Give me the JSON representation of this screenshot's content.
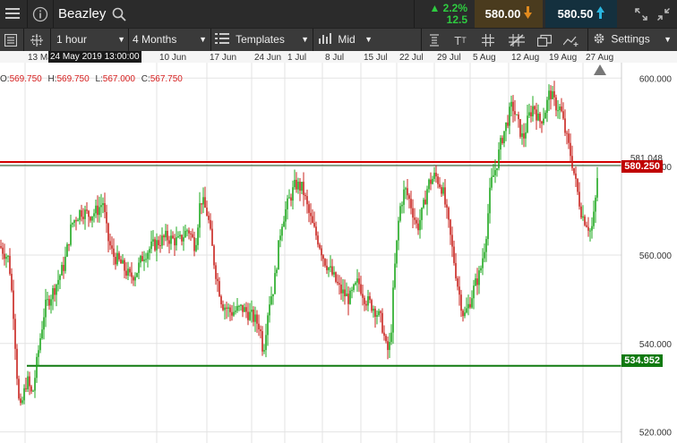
{
  "app": {
    "instrument": "Beazley",
    "change_pct": "▲ 2.2%",
    "change_abs": "12.5",
    "sell_price": "580.00",
    "buy_price": "580.50"
  },
  "toolbar": {
    "interval": "1 hour",
    "range": "4 Months",
    "templates": "Templates",
    "price_type": "Mid",
    "settings": "Settings"
  },
  "crosshair": {
    "date": "24 May 2019 13:00:00",
    "open_label": "O:",
    "open": "569.750",
    "high_label": "H:",
    "high": "569.750",
    "low_label": "L:",
    "low": "567.000",
    "close_label": "C:",
    "close": "567.750"
  },
  "colors": {
    "up": "#1fa81f",
    "down": "#c8231d",
    "resistance": "#d40000",
    "support": "#117a11",
    "price_line": "#1e4d1e"
  },
  "icons": [
    "menu-icon",
    "info-icon",
    "search-icon",
    "down-arrow-icon",
    "up-arrow-icon",
    "expand-icon",
    "collapse-icon",
    "list-icon",
    "crosshair-toggle-icon",
    "date-range-icon",
    "font-size-icon",
    "grid-icon",
    "drawing-tools-icon",
    "multi-window-icon",
    "add-indicator-icon",
    "gear-icon"
  ],
  "chart_data": {
    "type": "candlestick",
    "ylim": [
      517.5,
      603.5
    ],
    "y_ticks": [
      "520.000",
      "540.000",
      "560.000",
      "580.000",
      "600.000"
    ],
    "x_ticks": [
      "13 May",
      "10 Jun",
      "17 Jun",
      "24 Jun",
      "1 Jul",
      "8 Jul",
      "15 Jul",
      "22 Jul",
      "29 Jul",
      "5 Aug",
      "12 Aug",
      "19 Aug",
      "27 Aug"
    ],
    "hidden_tick_value": "581.048",
    "current_price": "580.250",
    "resistance_level": 581.048,
    "support_level": "534.952",
    "support_value": 534.952,
    "series_path": [
      [
        0,
        562
      ],
      [
        10,
        559
      ],
      [
        15,
        547
      ],
      [
        19,
        533
      ],
      [
        22,
        524
      ],
      [
        30,
        532
      ],
      [
        36,
        528
      ],
      [
        44,
        540
      ],
      [
        50,
        548
      ],
      [
        62,
        553
      ],
      [
        72,
        558
      ],
      [
        80,
        567
      ],
      [
        90,
        570
      ],
      [
        100,
        569
      ],
      [
        108,
        570
      ],
      [
        115,
        572
      ],
      [
        120,
        564
      ],
      [
        126,
        560
      ],
      [
        135,
        558
      ],
      [
        145,
        555
      ],
      [
        152,
        556
      ],
      [
        160,
        560
      ],
      [
        170,
        562
      ],
      [
        185,
        564
      ],
      [
        200,
        563
      ],
      [
        210,
        566
      ],
      [
        218,
        562
      ],
      [
        224,
        573
      ],
      [
        232,
        569
      ],
      [
        240,
        557
      ],
      [
        248,
        549
      ],
      [
        258,
        547
      ],
      [
        270,
        548
      ],
      [
        282,
        546
      ],
      [
        290,
        544
      ],
      [
        294,
        538
      ],
      [
        300,
        549
      ],
      [
        306,
        553
      ],
      [
        314,
        567
      ],
      [
        322,
        572
      ],
      [
        330,
        576
      ],
      [
        338,
        575
      ],
      [
        344,
        570
      ],
      [
        350,
        566
      ],
      [
        356,
        563
      ],
      [
        362,
        559
      ],
      [
        370,
        556
      ],
      [
        380,
        552
      ],
      [
        390,
        550
      ],
      [
        400,
        554
      ],
      [
        408,
        550
      ],
      [
        418,
        548
      ],
      [
        426,
        545
      ],
      [
        432,
        538
      ],
      [
        436,
        540
      ],
      [
        440,
        555
      ],
      [
        446,
        570
      ],
      [
        452,
        575
      ],
      [
        458,
        572
      ],
      [
        466,
        566
      ],
      [
        472,
        570
      ],
      [
        478,
        576
      ],
      [
        486,
        578
      ],
      [
        494,
        575
      ],
      [
        500,
        568
      ],
      [
        506,
        560
      ],
      [
        512,
        552
      ],
      [
        518,
        546
      ],
      [
        524,
        549
      ],
      [
        530,
        553
      ],
      [
        536,
        556
      ],
      [
        542,
        563
      ],
      [
        548,
        576
      ],
      [
        554,
        580
      ],
      [
        560,
        586
      ],
      [
        566,
        590
      ],
      [
        572,
        594
      ],
      [
        578,
        590
      ],
      [
        584,
        586
      ],
      [
        590,
        591
      ],
      [
        596,
        594
      ],
      [
        602,
        590
      ],
      [
        608,
        592
      ],
      [
        614,
        597
      ],
      [
        620,
        594
      ],
      [
        626,
        593
      ],
      [
        632,
        587
      ],
      [
        638,
        582
      ],
      [
        644,
        575
      ],
      [
        650,
        569
      ],
      [
        656,
        567
      ],
      [
        660,
        565
      ],
      [
        664,
        570
      ],
      [
        668,
        580
      ]
    ]
  }
}
